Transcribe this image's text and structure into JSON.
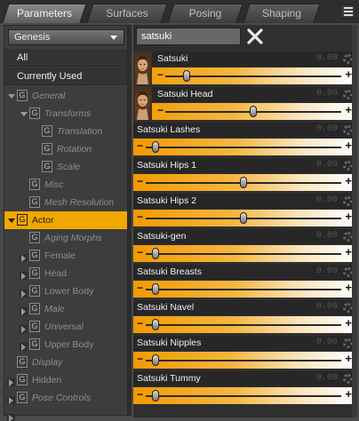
{
  "tabs": [
    {
      "label": "Parameters",
      "active": true
    },
    {
      "label": "Surfaces",
      "active": false
    },
    {
      "label": "Posing",
      "active": false
    },
    {
      "label": "Shaping",
      "active": false
    }
  ],
  "icons": {
    "menu": "hamburger-menu-icon",
    "clear": "close-x-icon",
    "group": "group-g-icon",
    "gear": "gear-icon"
  },
  "colors": {
    "accent": "#f0a800",
    "slider_start": "#f29a00",
    "slider_end": "#ffffff"
  },
  "figure_select": {
    "value": "Genesis"
  },
  "quick_filters": [
    "All",
    "Currently Used"
  ],
  "tree": [
    {
      "label": "General",
      "indent": 0,
      "arrow": "down",
      "style": "dim"
    },
    {
      "label": "Transforms",
      "indent": 1,
      "arrow": "down",
      "style": "dim"
    },
    {
      "label": "Translation",
      "indent": 2,
      "arrow": "",
      "style": "dim"
    },
    {
      "label": "Rotation",
      "indent": 2,
      "arrow": "",
      "style": "dim"
    },
    {
      "label": "Scale",
      "indent": 2,
      "arrow": "",
      "style": "dim"
    },
    {
      "label": "Misc",
      "indent": 1,
      "arrow": "",
      "style": "dim"
    },
    {
      "label": "Mesh Resolution",
      "indent": 1,
      "arrow": "",
      "style": "dim"
    },
    {
      "label": "Actor",
      "indent": 0,
      "arrow": "down",
      "style": "selected"
    },
    {
      "label": "Aging Morphs",
      "indent": 1,
      "arrow": "right",
      "style": "dim"
    },
    {
      "label": "Female",
      "indent": 1,
      "arrow": "right",
      "style": "normal"
    },
    {
      "label": "Head",
      "indent": 1,
      "arrow": "right",
      "style": "normal"
    },
    {
      "label": "Lower Body",
      "indent": 1,
      "arrow": "right",
      "style": "normal"
    },
    {
      "label": "Male",
      "indent": 1,
      "arrow": "right",
      "style": "dim"
    },
    {
      "label": "Universal",
      "indent": 1,
      "arrow": "right",
      "style": "dim"
    },
    {
      "label": "Upper Body",
      "indent": 1,
      "arrow": "right",
      "style": "normal"
    },
    {
      "label": "Display",
      "indent": 0,
      "arrow": "right",
      "style": "dim"
    },
    {
      "label": "Hidden",
      "indent": 0,
      "arrow": "right",
      "style": "normal"
    },
    {
      "label": "Pose Controls",
      "indent": 0,
      "arrow": "right",
      "style": "dim"
    }
  ],
  "search": {
    "value": "satsuki",
    "placeholder": ""
  },
  "sliders": [
    {
      "name": "Satsuki",
      "value": "0.00",
      "position": 0.12,
      "thumbnail": true
    },
    {
      "name": "Satsuki Head",
      "value": "0.00",
      "position": 0.5,
      "thumbnail": true
    },
    {
      "name": "Satsuki Lashes",
      "value": "0.00",
      "position": 0.05,
      "thumbnail": false
    },
    {
      "name": "Satsuki Hips 1",
      "value": "0.00",
      "position": 0.5,
      "thumbnail": false
    },
    {
      "name": "Satsuki Hips 2",
      "value": "0.00",
      "position": 0.5,
      "thumbnail": false
    },
    {
      "name": "Satsuki-gen",
      "value": "0.00",
      "position": 0.05,
      "thumbnail": false
    },
    {
      "name": "Satsuki Breasts",
      "value": "0.00",
      "position": 0.05,
      "thumbnail": false
    },
    {
      "name": "Satsuki Navel",
      "value": "0.00",
      "position": 0.05,
      "thumbnail": false
    },
    {
      "name": "Satsuki Nipples",
      "value": "0.00",
      "position": 0.05,
      "thumbnail": false
    },
    {
      "name": "Satsuki Tummy",
      "value": "0.00",
      "position": 0.05,
      "thumbnail": false
    }
  ]
}
